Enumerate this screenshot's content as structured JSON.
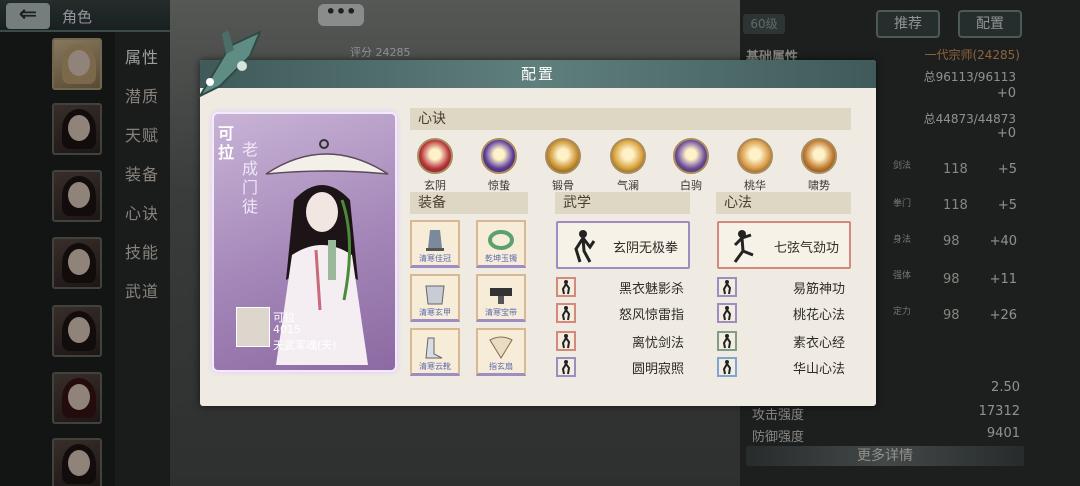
{
  "header": {
    "back_icon": "back-arrow-icon",
    "title": "角色",
    "chat_dots": "•••",
    "level": "60级",
    "recommend": "推荐",
    "config": "配置"
  },
  "sidebar": {
    "items": [
      {
        "label": "属性",
        "active": true
      },
      {
        "label": "潜质"
      },
      {
        "label": "天赋"
      },
      {
        "label": "装备"
      },
      {
        "label": "心诀"
      },
      {
        "label": "技能"
      },
      {
        "label": "武道"
      }
    ]
  },
  "bg_right": {
    "score": "评分 24285",
    "basic": "基础属性",
    "rank": "一代宗师(24285)",
    "hp_total": "总96113/96113",
    "hp_plus": "+0",
    "mp_total": "总44873/44873",
    "mp_plus": "+0",
    "stats": [
      {
        "name": "剑法",
        "val": "118",
        "plus": "+5"
      },
      {
        "name": "拳门",
        "val": "118",
        "plus": "+5"
      },
      {
        "name": "身法",
        "val": "98",
        "plus": "+40"
      },
      {
        "name": "强体",
        "val": "98",
        "plus": "+11"
      },
      {
        "name": "定力",
        "val": "98",
        "plus": "+26"
      }
    ],
    "speed": "2.50",
    "attack_label": "攻击强度",
    "attack": "17312",
    "defense_label": "防御强度",
    "defense": "9401",
    "more": "更多详情"
  },
  "dialog": {
    "title": "配置",
    "card": {
      "name": "可拉",
      "title": "老成门徒",
      "mini_name": "可拉",
      "mini_power": "4015",
      "mini_soul": "天武军魂(天)"
    },
    "xinjue": {
      "header": "心诀",
      "skills": [
        {
          "label": "玄阴",
          "color": "#b8323c",
          "icon": "crimson-orb-icon"
        },
        {
          "label": "惊蛰",
          "color": "#5a3a9c",
          "icon": "lightning-orb-icon"
        },
        {
          "label": "锻骨",
          "color": "#c8902e",
          "icon": "bone-orb-icon"
        },
        {
          "label": "气澜",
          "color": "#d8a03a",
          "icon": "qi-orb-icon"
        },
        {
          "label": "白驹",
          "color": "#6a4a9c",
          "icon": "horse-orb-icon"
        },
        {
          "label": "桃华",
          "color": "#d89a48",
          "icon": "peach-orb-icon"
        },
        {
          "label": "啸势",
          "color": "#c07a2e",
          "icon": "roar-orb-icon"
        }
      ]
    },
    "equip": {
      "header": "装备",
      "items": [
        {
          "label": "清寒佳冠",
          "icon": "crown-icon"
        },
        {
          "label": "乾坤玉镯",
          "icon": "bracelet-icon"
        },
        {
          "label": "清寒玄甲",
          "icon": "armor-icon"
        },
        {
          "label": "清寒宝带",
          "icon": "belt-icon"
        },
        {
          "label": "清寒云靴",
          "icon": "boots-icon"
        },
        {
          "label": "指玄扇",
          "icon": "fan-icon"
        }
      ]
    },
    "wuxue": {
      "header": "武学",
      "main": "玄阴无极拳",
      "list": [
        "黑衣魅影杀",
        "怒风惊雷指",
        "离忧剑法",
        "圆明寂照"
      ]
    },
    "xinfa": {
      "header": "心法",
      "main": "七弦气劲功",
      "list": [
        "易筋神功",
        "桃花心法",
        "素衣心经",
        "华山心法"
      ]
    }
  }
}
